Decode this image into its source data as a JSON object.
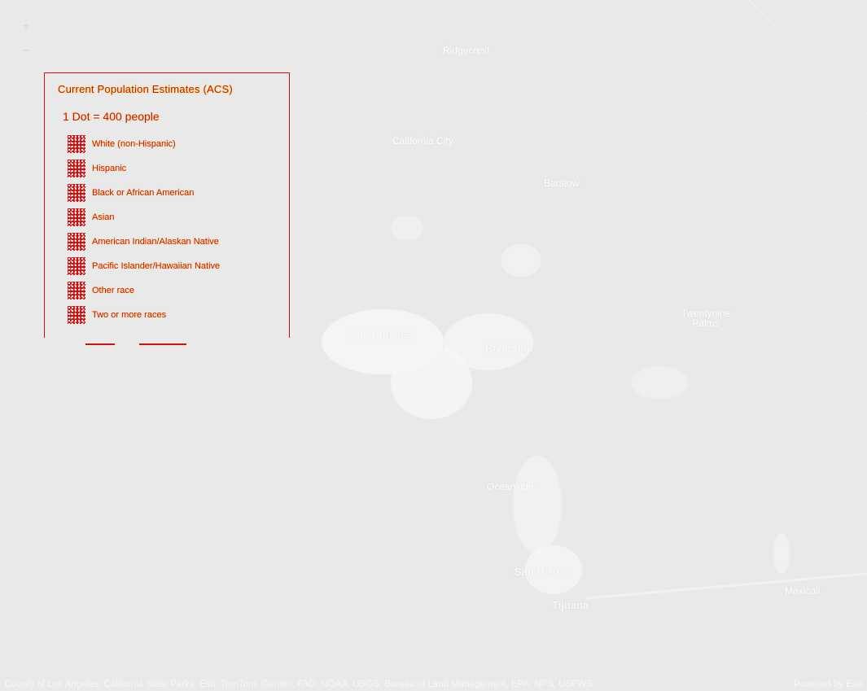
{
  "map": {
    "places": [
      {
        "id": "ridgecrest",
        "label": "Ridgecrest"
      },
      {
        "id": "california-city",
        "label": "California City"
      },
      {
        "id": "barstow",
        "label": "Barstow"
      },
      {
        "id": "los-angeles",
        "label": "Los Angeles"
      },
      {
        "id": "riverside",
        "label": "Riverside"
      },
      {
        "id": "twentynine-palms",
        "label": "Twentynine Palms"
      },
      {
        "id": "oceanside",
        "label": "Oceanside"
      },
      {
        "id": "san-diego",
        "label": "San Diego"
      },
      {
        "id": "tijuana",
        "label": "Tijuana"
      },
      {
        "id": "mexicali",
        "label": "Mexicali"
      }
    ]
  },
  "controls": {
    "zoom_in": "+",
    "zoom_out": "−"
  },
  "legend": {
    "title": "Current Population Estimates (ACS)",
    "scale": "1 Dot = 400 people",
    "items": [
      {
        "label": "White (non-Hispanic)"
      },
      {
        "label": "Hispanic"
      },
      {
        "label": "Black or African American"
      },
      {
        "label": "Asian"
      },
      {
        "label": "American Indian/Alaskan Native"
      },
      {
        "label": "Pacific Islander/Hawaiian Native"
      },
      {
        "label": "Other race"
      },
      {
        "label": "Two or more races"
      }
    ],
    "accent_color": "#d01010",
    "halo_color": "#ffe800"
  },
  "attribution": {
    "sources": "County of Los Angeles, California State Parks, Esri, TomTom, Garmin, FAO, NOAA, USGS, Bureau of Land Management, EPA, NPS, USFWS",
    "powered_by": "Powered by Esri"
  }
}
